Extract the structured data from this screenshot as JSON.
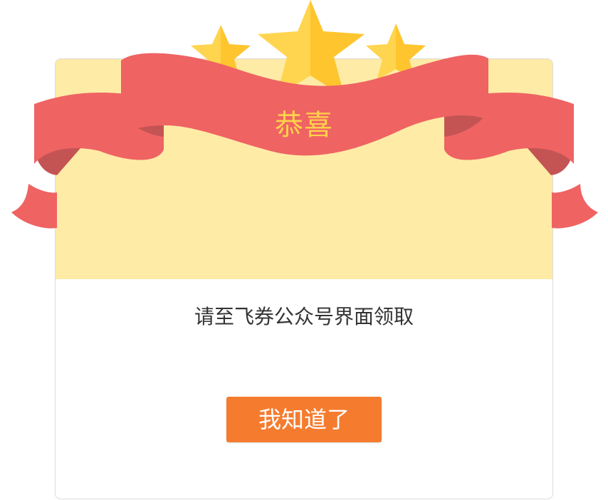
{
  "dialog": {
    "title": "恭喜",
    "message": "请至飞券公众号界面领取",
    "confirm_label": "我知道了"
  },
  "colors": {
    "ribbon": "#ef6363",
    "ribbon_shadow": "#c45454",
    "banner_background": "#feeba6",
    "star": "#ffd54f",
    "star_shade": "#ffc52f",
    "title_text": "#ffd24a",
    "button": "#f57c2f",
    "button_text": "#ffffff",
    "message_text": "#333333"
  },
  "icons": [
    "star-icon",
    "star-icon",
    "star-icon",
    "ribbon-banner"
  ]
}
